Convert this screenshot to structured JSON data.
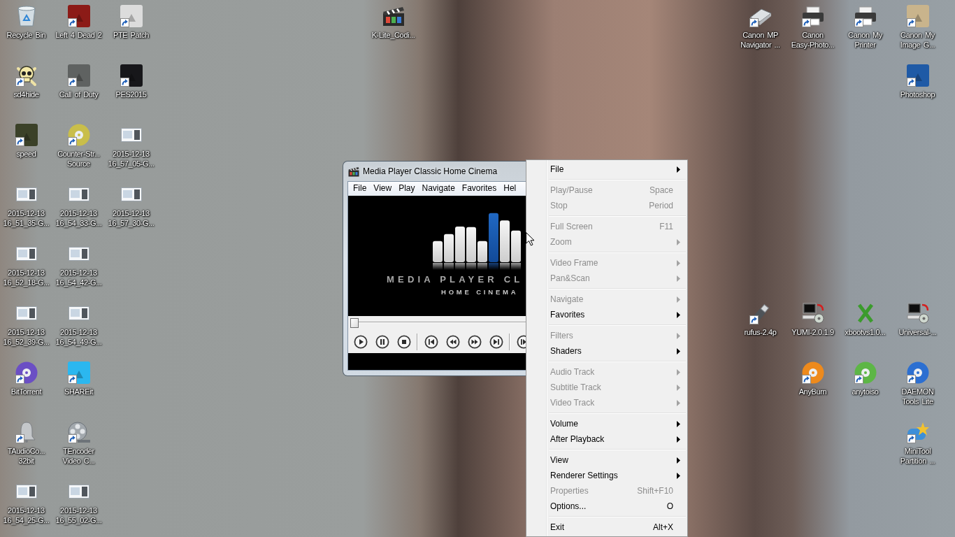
{
  "desktop": {
    "left_icons": [
      [
        {
          "label": "Recycle Bin",
          "kind": "bin",
          "shortcut": false
        },
        {
          "label": "Left 4 Dead 2",
          "kind": "tile",
          "color": "#8c1b17",
          "shortcut": true
        },
        {
          "label": "PTE Patch",
          "kind": "tile",
          "color": "#dcdcdc",
          "shortcut": true
        }
      ],
      [
        {
          "label": "sd4hide",
          "kind": "skull",
          "shortcut": true
        },
        {
          "label": "Call of Duty",
          "kind": "tile",
          "color": "#5f6261",
          "shortcut": true
        },
        {
          "label": "PES2015",
          "kind": "tile",
          "color": "#17171a",
          "shortcut": true
        }
      ],
      [
        {
          "label": "speed",
          "kind": "tile",
          "color": "#3b4128",
          "shortcut": true
        },
        {
          "label": "Counter-Str... Source",
          "kind": "disc",
          "color": "#c9be4a",
          "shortcut": true
        },
        {
          "label": "2015-12-13 16_57_05-G...",
          "kind": "picture",
          "shortcut": false
        }
      ],
      [
        {
          "label": "2015-12-13 16_51_35-G...",
          "kind": "picture",
          "shortcut": false
        },
        {
          "label": "2015-12-13 16_54_33-G...",
          "kind": "picture",
          "shortcut": false
        },
        {
          "label": "2015-12-13 16_57_30-G...",
          "kind": "picture",
          "shortcut": false
        }
      ],
      [
        {
          "label": "2015-12-13 16_52_18-G...",
          "kind": "picture",
          "shortcut": false
        },
        {
          "label": "2015-12-13 16_54_42-G...",
          "kind": "picture",
          "shortcut": false
        }
      ],
      [
        {
          "label": "2015-12-13 16_52_39-G...",
          "kind": "picture",
          "shortcut": false
        },
        {
          "label": "2015-12-13 16_54_49-G...",
          "kind": "picture",
          "shortcut": false
        }
      ],
      [
        {
          "label": "BitTorrent",
          "kind": "disc",
          "color": "#6b4fc4",
          "shortcut": true
        },
        {
          "label": "SHAREit",
          "kind": "tile",
          "color": "#2bb7ef",
          "shortcut": true
        }
      ],
      [
        {
          "label": "TAudioCo... 32bit",
          "kind": "bell",
          "shortcut": true
        },
        {
          "label": "TEncoder Video C...",
          "kind": "reel",
          "shortcut": true
        }
      ],
      [
        {
          "label": "2015-12-13 16_54_25-G...",
          "kind": "picture",
          "shortcut": false
        },
        {
          "label": "2015-12-13 16_55_02-G...",
          "kind": "picture",
          "shortcut": false
        }
      ]
    ],
    "top_icons": [
      {
        "label": "K-Lite_Codi...",
        "kind": "clapper",
        "shortcut": false
      }
    ],
    "right_top_icons": [
      [
        {
          "label": "Canon MP Navigator ...",
          "kind": "scanner",
          "shortcut": true
        },
        {
          "label": "Canon Easy-Photo...",
          "kind": "printer",
          "shortcut": true
        },
        {
          "label": "Canon My Printer",
          "kind": "printer",
          "shortcut": true
        },
        {
          "label": "Canon My Image G...",
          "kind": "tile",
          "color": "#c9b48c",
          "shortcut": true
        }
      ],
      [
        {
          "label": "Photoshop",
          "kind": "tile",
          "color": "#1f5aa6",
          "shortcut": true
        }
      ]
    ],
    "right_middle_icons": [
      [
        {
          "label": "rufus-2.4p",
          "kind": "usb",
          "shortcut": true
        },
        {
          "label": "YUMI-2.0.1.9",
          "kind": "computer",
          "shortcut": false
        },
        {
          "label": "xbootvs1.0...",
          "kind": "cross",
          "shortcut": false
        },
        {
          "label": "Universal-...",
          "kind": "computer",
          "shortcut": false
        }
      ],
      [
        {
          "label": "AnyBurn",
          "kind": "disc",
          "color": "#ee8a1c",
          "shortcut": true
        },
        {
          "label": "anytoiso",
          "kind": "disc",
          "color": "#5db646",
          "shortcut": true
        },
        {
          "label": "DAEMON Tools Lite",
          "kind": "disc",
          "color": "#2c6fd1",
          "shortcut": true
        }
      ],
      [
        {
          "label": "MiniTool Partition ...",
          "kind": "box",
          "shortcut": true
        }
      ]
    ]
  },
  "player_window": {
    "title": "Media Player Classic Home Cinema",
    "menu": [
      "File",
      "View",
      "Play",
      "Navigate",
      "Favorites",
      "Hel"
    ],
    "logo_title": "MEDIA PLAYER CL",
    "logo_subtitle": "HOME CINEMA",
    "seek": {
      "level": 0
    },
    "control_groups": [
      [
        {
          "kind": "play"
        },
        {
          "kind": "pause"
        },
        {
          "kind": "stop"
        }
      ],
      [
        {
          "kind": "previous"
        },
        {
          "kind": "rewind"
        },
        {
          "kind": "forward"
        },
        {
          "kind": "next"
        }
      ],
      [
        {
          "kind": "frame-step"
        }
      ]
    ]
  },
  "context_menu": {
    "groups": [
      [
        {
          "label": "File",
          "submenu": true,
          "disabled": false
        }
      ],
      [
        {
          "label": "Play/Pause",
          "shortcut": "Space",
          "submenu": false,
          "disabled": true
        },
        {
          "label": "Stop",
          "shortcut": "Period",
          "submenu": false,
          "disabled": true
        }
      ],
      [
        {
          "label": "Full Screen",
          "shortcut": "F11",
          "submenu": false,
          "disabled": true
        },
        {
          "label": "Zoom",
          "submenu": true,
          "disabled": true
        }
      ],
      [
        {
          "label": "Video Frame",
          "submenu": true,
          "disabled": true
        },
        {
          "label": "Pan&Scan",
          "submenu": true,
          "disabled": true
        }
      ],
      [
        {
          "label": "Navigate",
          "submenu": true,
          "disabled": true
        },
        {
          "label": "Favorites",
          "submenu": true,
          "disabled": false
        }
      ],
      [
        {
          "label": "Filters",
          "submenu": true,
          "disabled": true
        },
        {
          "label": "Shaders",
          "submenu": true,
          "disabled": false
        }
      ],
      [
        {
          "label": "Audio Track",
          "submenu": true,
          "disabled": true
        },
        {
          "label": "Subtitle Track",
          "submenu": true,
          "disabled": true
        },
        {
          "label": "Video Track",
          "submenu": true,
          "disabled": true
        }
      ],
      [
        {
          "label": "Volume",
          "submenu": true,
          "disabled": false
        },
        {
          "label": "After Playback",
          "submenu": true,
          "disabled": false
        }
      ],
      [
        {
          "label": "View",
          "submenu": true,
          "disabled": false
        },
        {
          "label": "Renderer Settings",
          "submenu": true,
          "disabled": false
        },
        {
          "label": "Properties",
          "shortcut": "Shift+F10",
          "submenu": false,
          "disabled": true
        },
        {
          "label": "Options...",
          "shortcut": "O",
          "submenu": false,
          "disabled": false
        }
      ],
      [
        {
          "label": "Exit",
          "shortcut": "Alt+X",
          "submenu": false,
          "disabled": false
        }
      ]
    ]
  }
}
